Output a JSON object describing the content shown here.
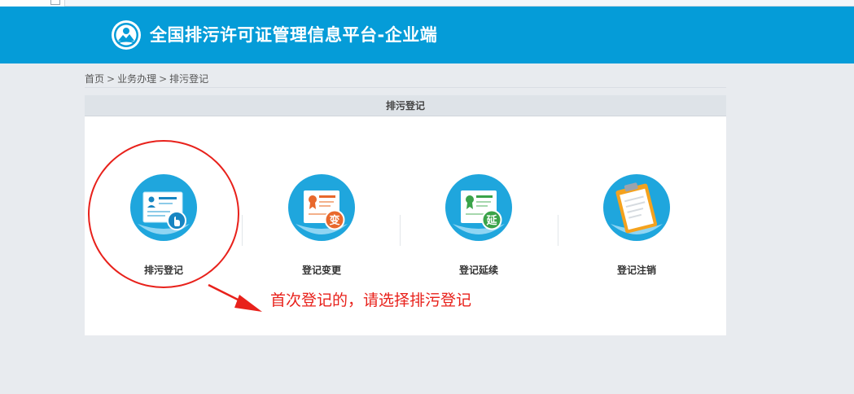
{
  "header": {
    "title": "全国排污许可证管理信息平台-企业端",
    "logo_icon": "environmental-protection-emblem-icon",
    "background_color": "#059cd8"
  },
  "breadcrumb": {
    "items": [
      "首页",
      "业务办理",
      "排污登记"
    ],
    "separator": ">"
  },
  "panel": {
    "title": "排污登记"
  },
  "services": [
    {
      "label": "排污登记",
      "icon": "registration-card-hand-icon"
    },
    {
      "label": "登记变更",
      "icon": "certificate-change-icon",
      "badge": "变"
    },
    {
      "label": "登记延续",
      "icon": "certificate-extend-icon",
      "badge": "延"
    },
    {
      "label": "登记注销",
      "icon": "clipboard-cancel-icon"
    }
  ],
  "annotation": {
    "text": "首次登记的，请选择排污登记",
    "color": "#e8211b"
  }
}
